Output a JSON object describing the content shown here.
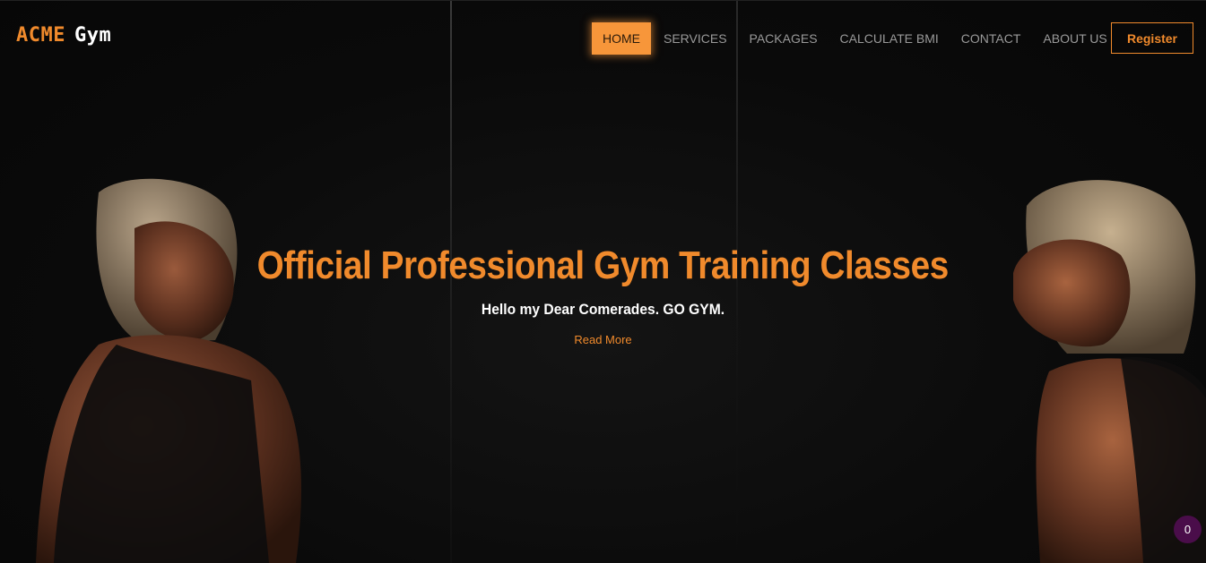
{
  "brand": {
    "first": "ACME",
    "second": "Gym"
  },
  "nav": {
    "items": [
      {
        "label": "HOME",
        "active": true
      },
      {
        "label": "SERVICES",
        "active": false
      },
      {
        "label": "PACKAGES",
        "active": false
      },
      {
        "label": "CALCULATE BMI",
        "active": false
      },
      {
        "label": "CONTACT",
        "active": false
      },
      {
        "label": "ABOUT US",
        "active": false
      }
    ],
    "register_label": "Register"
  },
  "hero": {
    "title": "Official Professional Gym Training Classes",
    "subtitle": "Hello my Dear Comerades. GO GYM.",
    "cta_label": "Read More"
  },
  "floating_badge": {
    "count": "0"
  },
  "colors": {
    "accent": "#f08a2c",
    "active_bg": "#f7963a",
    "badge_bg": "#4a0d4a",
    "background": "#0b0b0c"
  }
}
